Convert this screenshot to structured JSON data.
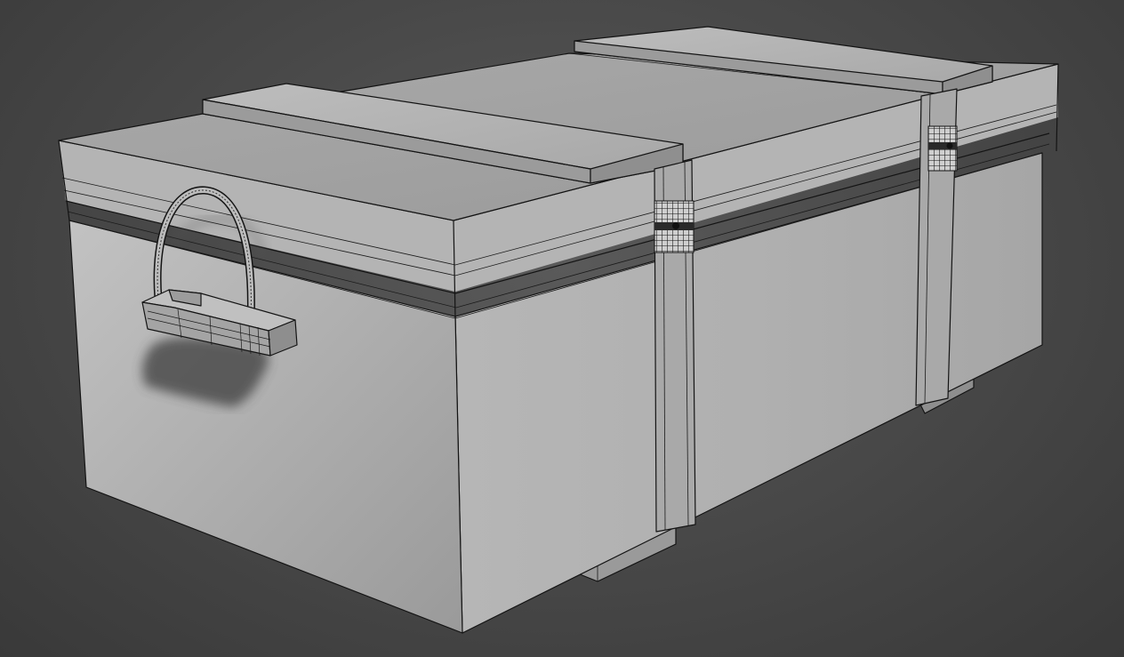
{
  "viewport": {
    "background_color": "#404040",
    "model_color": "#b8b8b8",
    "edge_color": "#141414",
    "shading_mode": "edged-faces"
  },
  "model": {
    "object": "wooden-crate",
    "parts": [
      "crate-body",
      "lid",
      "lid-slat-left",
      "lid-slat-right",
      "strap-left",
      "strap-right",
      "side-handle",
      "skid-front",
      "skid-back",
      "latch-left",
      "latch-right"
    ]
  }
}
